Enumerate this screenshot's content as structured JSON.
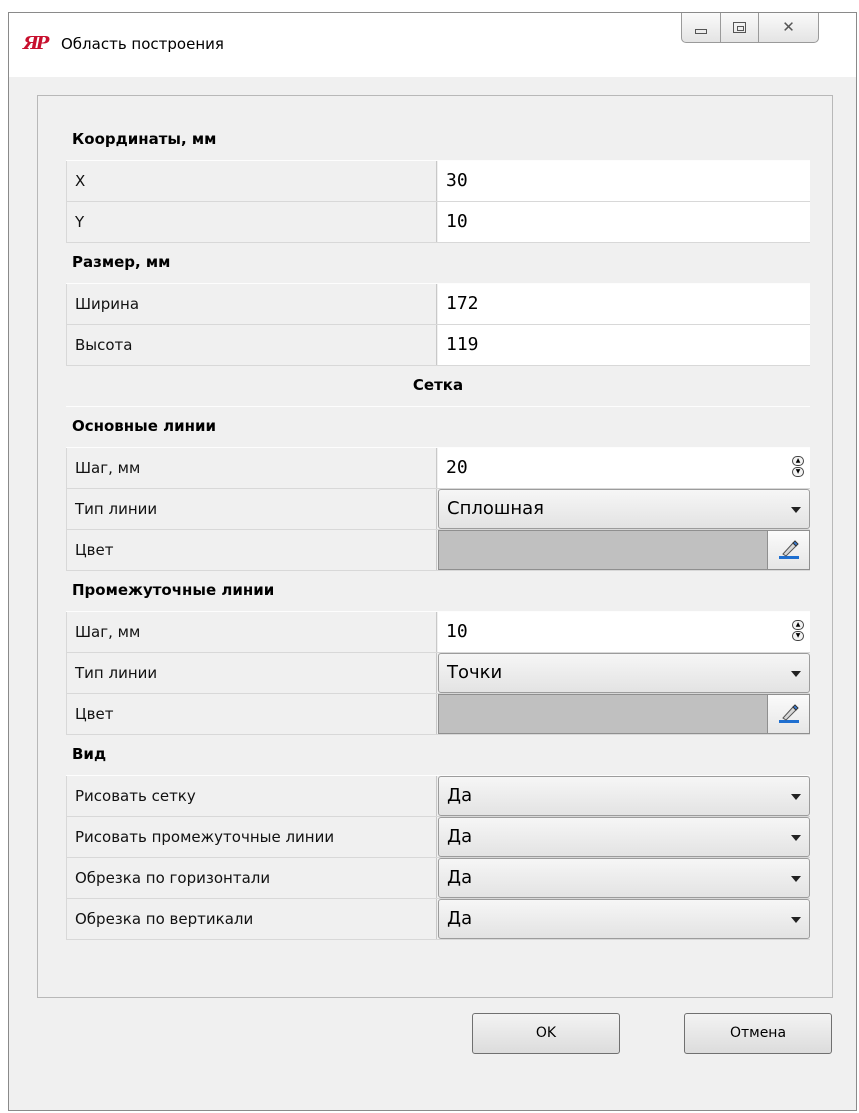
{
  "window": {
    "title": "Область построения"
  },
  "sections": {
    "coords": "Координаты, мм",
    "size": "Размер, мм",
    "grid": "Сетка",
    "main_lines": "Основные линии",
    "inter_lines": "Промежуточные линии",
    "view": "Вид"
  },
  "coords": {
    "x_label": "X",
    "x_value": "30",
    "y_label": "Y",
    "y_value": "10"
  },
  "size": {
    "width_label": "Ширина",
    "width_value": "172",
    "height_label": "Высота",
    "height_value": "119"
  },
  "main_lines": {
    "step_label": "Шаг, мм",
    "step_value": "20",
    "type_label": "Тип линии",
    "type_value": "Сплошная",
    "color_label": "Цвет",
    "color_value": "#c0c0c0"
  },
  "inter_lines": {
    "step_label": "Шаг, мм",
    "step_value": "10",
    "type_label": "Тип линии",
    "type_value": "Точки",
    "color_label": "Цвет",
    "color_value": "#c0c0c0"
  },
  "view": {
    "draw_grid_label": "Рисовать сетку",
    "draw_grid_value": "Да",
    "draw_inter_label": "Рисовать промежуточные линии",
    "draw_inter_value": "Да",
    "clip_h_label": "Обрезка по горизонтали",
    "clip_h_value": "Да",
    "clip_v_label": "Обрезка по вертикали",
    "clip_v_value": "Да"
  },
  "buttons": {
    "ok": "OK",
    "cancel": "Отмена"
  },
  "icons": {
    "app": "app-logo-icon",
    "minimize": "minimize-icon",
    "maximize": "maximize-icon",
    "close": "close-icon",
    "color_picker": "color-picker-icon"
  }
}
